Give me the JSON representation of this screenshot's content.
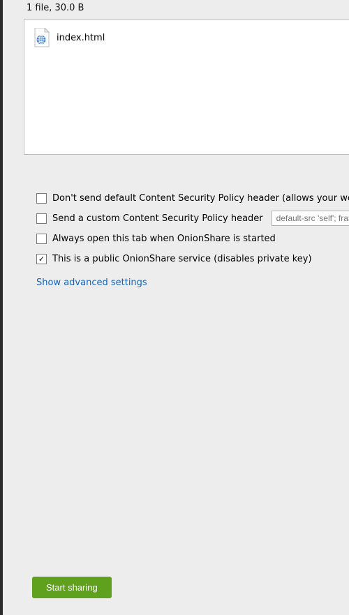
{
  "file_summary": "1 file, 30.0 B",
  "files": [
    {
      "name": "index.html"
    }
  ],
  "options": {
    "csp_default": {
      "label": "Don't send default Content Security Policy header (allows your website",
      "checked": false
    },
    "csp_custom": {
      "label": "Send a custom Content Security Policy header",
      "checked": false,
      "placeholder": "default-src 'self'; frame"
    },
    "always_open": {
      "label": "Always open this tab when OnionShare is started",
      "checked": false
    },
    "public_service": {
      "label": "This is a public OnionShare service (disables private key)",
      "checked": true
    }
  },
  "advanced_link": "Show advanced settings",
  "start_button": "Start sharing",
  "colors": {
    "accent": "#5fa01c",
    "link": "#1565c0"
  }
}
